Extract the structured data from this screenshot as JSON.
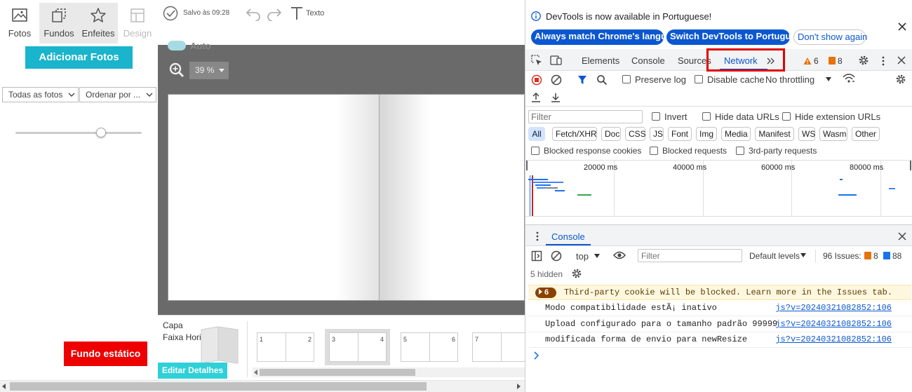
{
  "editor": {
    "tabs": [
      {
        "label": "Fotos",
        "icon": "image-icon"
      },
      {
        "label": "Fundos",
        "icon": "layers-icon"
      },
      {
        "label": "Enfeites",
        "icon": "star-icon"
      },
      {
        "label": "Design",
        "icon": "layout-icon"
      }
    ],
    "saved_status": "Salvo às 09:28",
    "text_tool_label": "Texto",
    "add_photos_label": "Adicionar Fotos",
    "filter_select": "Todas as fotos",
    "sort_select": "Ordenar por ...",
    "slider_value": 0.68,
    "auto_label": "Auto",
    "zoom_value": "39 %",
    "static_bg_button": "Fundo estático",
    "cover_label": "Capa",
    "cover_sub": "Faixa Horizontal",
    "edit_details_label": "Editar Detalhes",
    "thumbs": [
      {
        "left": "1",
        "right": "2"
      },
      {
        "left": "3",
        "right": "4"
      },
      {
        "left": "5",
        "right": "6"
      },
      {
        "left": "7",
        "right": ""
      }
    ],
    "colors": {
      "accent": "#1ab4cc",
      "danger": "#ee0000"
    }
  },
  "devtools": {
    "banner": {
      "message": "DevTools is now available in Portuguese!",
      "btn_match": "Always match Chrome's language",
      "btn_switch": "Switch DevTools to Portuguese",
      "btn_dismiss": "Don't show again"
    },
    "tabs": [
      "Elements",
      "Console",
      "Sources",
      "Network"
    ],
    "active_tab": "Network",
    "warnings_count": "6",
    "errors_count": "8",
    "network": {
      "preserve_log": "Preserve log",
      "disable_cache": "Disable cache",
      "throttling": "No throttling",
      "filter_placeholder": "Filter",
      "invert": "Invert",
      "hide_data_urls": "Hide data URLs",
      "hide_extension_urls": "Hide extension URLs",
      "type_filters": [
        "All",
        "Fetch/XHR",
        "Doc",
        "CSS",
        "JS",
        "Font",
        "Img",
        "Media",
        "Manifest",
        "WS",
        "Wasm",
        "Other"
      ],
      "blocked_cookies": "Blocked response cookies",
      "blocked_requests": "Blocked requests",
      "third_party": "3rd-party requests",
      "timeline_ticks": [
        "20000 ms",
        "40000 ms",
        "60000 ms",
        "80000 ms"
      ]
    },
    "console_drawer": {
      "title": "Console",
      "context": "top",
      "filter_placeholder": "Filter",
      "levels": "Default levels",
      "issues_label": "96 Issues:",
      "issues_errors": "8",
      "issues_info": "88",
      "hidden": "5 hidden",
      "warning_count": "6",
      "warning_text": "Third-party cookie will be blocked. Learn more in the Issues tab.",
      "logs": [
        {
          "msg": "Modo compatibilidade estÃ¡  inativo",
          "src": "js?v=20240321082852:106"
        },
        {
          "msg": "Upload configurado para o tamanho padrão 99999",
          "src": "js?v=20240321082852:106"
        },
        {
          "msg": "modificada forma de envio para newResize",
          "src": "js?v=20240321082852:106"
        }
      ]
    }
  }
}
